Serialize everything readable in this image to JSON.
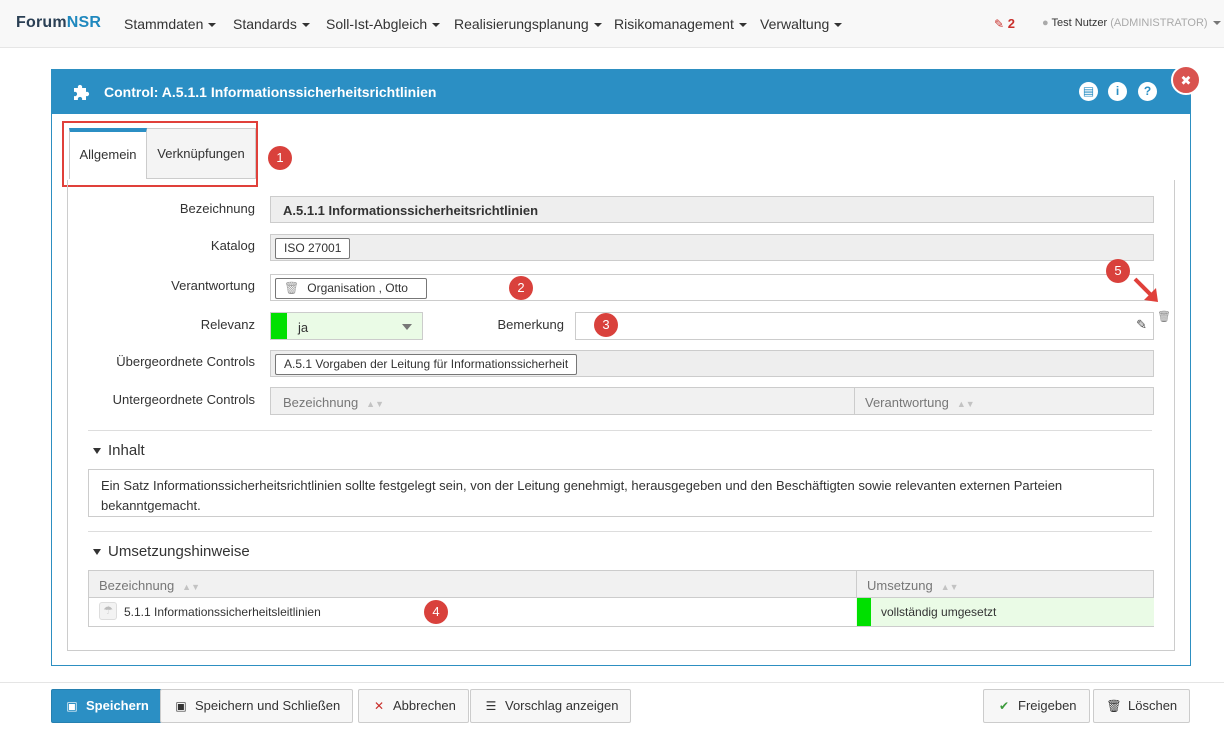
{
  "topbar": {
    "brand_1": "Forum",
    "brand_2": "NSR",
    "menu": [
      "Stammdaten",
      "Standards",
      "Soll-Ist-Abgleich",
      "Realisierungsplanung",
      "Risikomanagement",
      "Verwaltung"
    ],
    "edit_count": "2",
    "user_name": "Test Nutzer",
    "user_role": "(ADMINISTRATOR)"
  },
  "dialog": {
    "title": "Control: A.5.1.1 Informationssicherheitsrichtlinien",
    "tabs": [
      "Allgemein",
      "Verknüpfungen"
    ],
    "fields": {
      "bezeichnung_label": "Bezeichnung",
      "bezeichnung_value": "A.5.1.1 Informationssicherheitsrichtlinien",
      "katalog_label": "Katalog",
      "katalog_value": "ISO 27001",
      "verantwortung_label": "Verantwortung",
      "verantwortung_value": "Organisation , Otto",
      "relevanz_label": "Relevanz",
      "relevanz_value": "ja",
      "bemerkung_label": "Bemerkung",
      "bemerkung_value": "",
      "uebergeordnet_label": "Übergeordnete Controls",
      "uebergeordnet_value": "A.5.1 Vorgaben der Leitung für Informationssicherheit",
      "untergeordnet_label": "Untergeordnete Controls",
      "untergeordnet_cols": [
        "Bezeichnung",
        "Verantwortung"
      ]
    },
    "inhalt": {
      "title": "Inhalt",
      "text": "Ein Satz Informationssicherheitsrichtlinien sollte festgelegt sein, von der Leitung genehmigt, herausgegeben und den Beschäftigten sowie relevanten externen Parteien bekanntgemacht."
    },
    "umsetzung": {
      "title": "Umsetzungshinweise",
      "cols": [
        "Bezeichnung",
        "Umsetzung"
      ],
      "rows": [
        {
          "name": "5.1.1 Informationssicherheitsleitlinien",
          "status": "vollständig umgesetzt"
        }
      ]
    }
  },
  "annotations": [
    "1",
    "2",
    "3",
    "4",
    "5"
  ],
  "buttons": {
    "save": "Speichern",
    "save_close": "Speichern und Schließen",
    "cancel": "Abbrechen",
    "suggestion": "Vorschlag anzeigen",
    "release": "Freigeben",
    "delete": "Löschen"
  },
  "colors": {
    "header_blue": "#2b8fc4",
    "status_green": "#00e000",
    "annotation_red": "#d9413c"
  }
}
